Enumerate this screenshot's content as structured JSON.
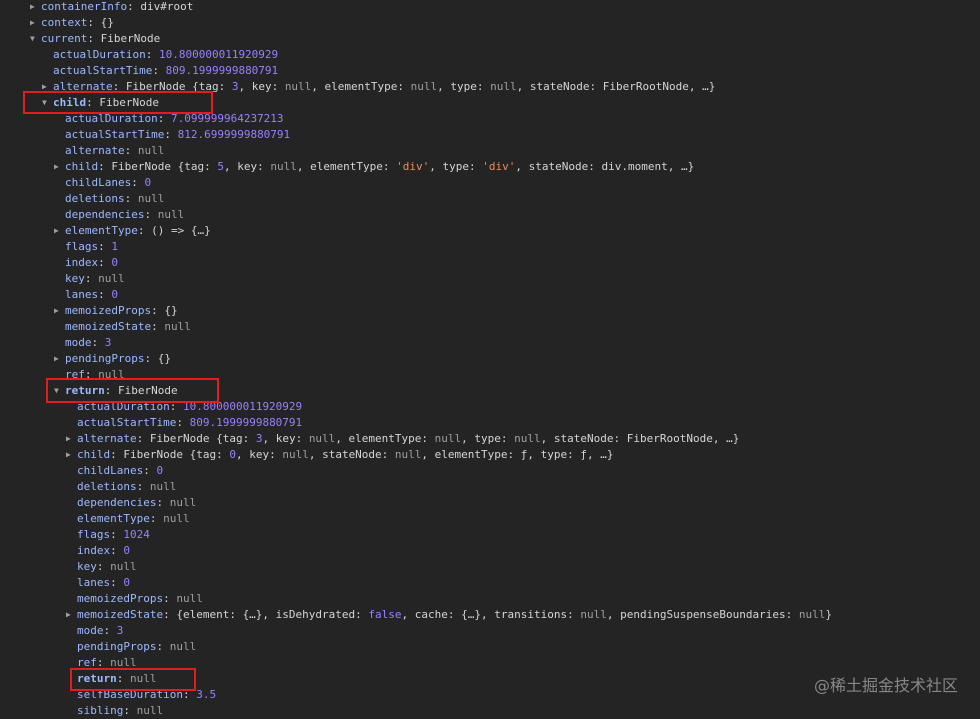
{
  "watermark": "@稀土掘金技术社区",
  "rows": [
    {
      "indent": 0,
      "tri": "right",
      "parts": [
        [
          "k",
          "containerInfo"
        ],
        [
          "p",
          ": "
        ],
        [
          "v",
          "div#root"
        ]
      ]
    },
    {
      "indent": 0,
      "tri": "right",
      "parts": [
        [
          "k",
          "context"
        ],
        [
          "p",
          ": {}"
        ]
      ]
    },
    {
      "indent": 0,
      "tri": "down",
      "parts": [
        [
          "k",
          "current"
        ],
        [
          "p",
          ": "
        ],
        [
          "v",
          "FiberNode"
        ]
      ]
    },
    {
      "indent": 1,
      "tri": "none",
      "parts": [
        [
          "k",
          "actualDuration"
        ],
        [
          "p",
          ": "
        ],
        [
          "num",
          "10.800000011920929"
        ]
      ]
    },
    {
      "indent": 1,
      "tri": "none",
      "parts": [
        [
          "k",
          "actualStartTime"
        ],
        [
          "p",
          ": "
        ],
        [
          "num",
          "809.1999999880791"
        ]
      ]
    },
    {
      "indent": 1,
      "tri": "right",
      "parts": [
        [
          "k",
          "alternate"
        ],
        [
          "p",
          ": "
        ],
        [
          "v",
          "FiberNode {tag: "
        ],
        [
          "num",
          "3"
        ],
        [
          "v",
          ", key: "
        ],
        [
          "n",
          "null"
        ],
        [
          "v",
          ", elementType: "
        ],
        [
          "n",
          "null"
        ],
        [
          "v",
          ", type: "
        ],
        [
          "n",
          "null"
        ],
        [
          "v",
          ", stateNode: "
        ],
        [
          "v",
          "FiberRootNode"
        ],
        [
          "v",
          ", …}"
        ]
      ]
    },
    {
      "indent": 1,
      "tri": "down",
      "parts": [
        [
          "kb",
          "child"
        ],
        [
          "p",
          ": "
        ],
        [
          "v",
          "FiberNode"
        ]
      ]
    },
    {
      "indent": 2,
      "tri": "none",
      "parts": [
        [
          "k",
          "actualDuration"
        ],
        [
          "p",
          ": "
        ],
        [
          "num",
          "7.099999964237213"
        ]
      ]
    },
    {
      "indent": 2,
      "tri": "none",
      "parts": [
        [
          "k",
          "actualStartTime"
        ],
        [
          "p",
          ": "
        ],
        [
          "num",
          "812.6999999880791"
        ]
      ]
    },
    {
      "indent": 2,
      "tri": "none",
      "parts": [
        [
          "k",
          "alternate"
        ],
        [
          "p",
          ": "
        ],
        [
          "n",
          "null"
        ]
      ]
    },
    {
      "indent": 2,
      "tri": "right",
      "parts": [
        [
          "k",
          "child"
        ],
        [
          "p",
          ": "
        ],
        [
          "v",
          "FiberNode {tag: "
        ],
        [
          "num",
          "5"
        ],
        [
          "v",
          ", key: "
        ],
        [
          "n",
          "null"
        ],
        [
          "v",
          ", elementType: "
        ],
        [
          "str",
          "'div'"
        ],
        [
          "v",
          ", type: "
        ],
        [
          "str",
          "'div'"
        ],
        [
          "v",
          ", stateNode: "
        ],
        [
          "v",
          "div.moment"
        ],
        [
          "v",
          ", …}"
        ]
      ]
    },
    {
      "indent": 2,
      "tri": "none",
      "parts": [
        [
          "k",
          "childLanes"
        ],
        [
          "p",
          ": "
        ],
        [
          "num",
          "0"
        ]
      ]
    },
    {
      "indent": 2,
      "tri": "none",
      "parts": [
        [
          "k",
          "deletions"
        ],
        [
          "p",
          ": "
        ],
        [
          "n",
          "null"
        ]
      ]
    },
    {
      "indent": 2,
      "tri": "none",
      "parts": [
        [
          "k",
          "dependencies"
        ],
        [
          "p",
          ": "
        ],
        [
          "n",
          "null"
        ]
      ]
    },
    {
      "indent": 2,
      "tri": "right",
      "parts": [
        [
          "k",
          "elementType"
        ],
        [
          "p",
          ": "
        ],
        [
          "v",
          "() => {…}"
        ]
      ]
    },
    {
      "indent": 2,
      "tri": "none",
      "parts": [
        [
          "k",
          "flags"
        ],
        [
          "p",
          ": "
        ],
        [
          "num",
          "1"
        ]
      ]
    },
    {
      "indent": 2,
      "tri": "none",
      "parts": [
        [
          "k",
          "index"
        ],
        [
          "p",
          ": "
        ],
        [
          "num",
          "0"
        ]
      ]
    },
    {
      "indent": 2,
      "tri": "none",
      "parts": [
        [
          "k",
          "key"
        ],
        [
          "p",
          ": "
        ],
        [
          "n",
          "null"
        ]
      ]
    },
    {
      "indent": 2,
      "tri": "none",
      "parts": [
        [
          "k",
          "lanes"
        ],
        [
          "p",
          ": "
        ],
        [
          "num",
          "0"
        ]
      ]
    },
    {
      "indent": 2,
      "tri": "right",
      "parts": [
        [
          "k",
          "memoizedProps"
        ],
        [
          "p",
          ": {}"
        ]
      ]
    },
    {
      "indent": 2,
      "tri": "none",
      "parts": [
        [
          "k",
          "memoizedState"
        ],
        [
          "p",
          ": "
        ],
        [
          "n",
          "null"
        ]
      ]
    },
    {
      "indent": 2,
      "tri": "none",
      "parts": [
        [
          "k",
          "mode"
        ],
        [
          "p",
          ": "
        ],
        [
          "num",
          "3"
        ]
      ]
    },
    {
      "indent": 2,
      "tri": "right",
      "parts": [
        [
          "k",
          "pendingProps"
        ],
        [
          "p",
          ": {}"
        ]
      ]
    },
    {
      "indent": 2,
      "tri": "none",
      "parts": [
        [
          "k",
          "ref"
        ],
        [
          "p",
          ": "
        ],
        [
          "n",
          "null"
        ]
      ]
    },
    {
      "indent": 2,
      "tri": "down",
      "parts": [
        [
          "kb",
          "return"
        ],
        [
          "p",
          ": "
        ],
        [
          "v",
          "FiberNode"
        ]
      ]
    },
    {
      "indent": 3,
      "tri": "none",
      "parts": [
        [
          "k",
          "actualDuration"
        ],
        [
          "p",
          ": "
        ],
        [
          "num",
          "10.800000011920929"
        ]
      ]
    },
    {
      "indent": 3,
      "tri": "none",
      "parts": [
        [
          "k",
          "actualStartTime"
        ],
        [
          "p",
          ": "
        ],
        [
          "num",
          "809.1999999880791"
        ]
      ]
    },
    {
      "indent": 3,
      "tri": "right",
      "parts": [
        [
          "k",
          "alternate"
        ],
        [
          "p",
          ": "
        ],
        [
          "v",
          "FiberNode {tag: "
        ],
        [
          "num",
          "3"
        ],
        [
          "v",
          ", key: "
        ],
        [
          "n",
          "null"
        ],
        [
          "v",
          ", elementType: "
        ],
        [
          "n",
          "null"
        ],
        [
          "v",
          ", type: "
        ],
        [
          "n",
          "null"
        ],
        [
          "v",
          ", stateNode: "
        ],
        [
          "v",
          "FiberRootNode"
        ],
        [
          "v",
          ", …}"
        ]
      ]
    },
    {
      "indent": 3,
      "tri": "right",
      "parts": [
        [
          "k",
          "child"
        ],
        [
          "p",
          ": "
        ],
        [
          "v",
          "FiberNode {tag: "
        ],
        [
          "num",
          "0"
        ],
        [
          "v",
          ", key: "
        ],
        [
          "n",
          "null"
        ],
        [
          "v",
          ", stateNode: "
        ],
        [
          "n",
          "null"
        ],
        [
          "v",
          ", elementType: "
        ],
        [
          "v",
          "ƒ"
        ],
        [
          "v",
          ", type: "
        ],
        [
          "v",
          "ƒ"
        ],
        [
          "v",
          ", …}"
        ]
      ]
    },
    {
      "indent": 3,
      "tri": "none",
      "parts": [
        [
          "k",
          "childLanes"
        ],
        [
          "p",
          ": "
        ],
        [
          "num",
          "0"
        ]
      ]
    },
    {
      "indent": 3,
      "tri": "none",
      "parts": [
        [
          "k",
          "deletions"
        ],
        [
          "p",
          ": "
        ],
        [
          "n",
          "null"
        ]
      ]
    },
    {
      "indent": 3,
      "tri": "none",
      "parts": [
        [
          "k",
          "dependencies"
        ],
        [
          "p",
          ": "
        ],
        [
          "n",
          "null"
        ]
      ]
    },
    {
      "indent": 3,
      "tri": "none",
      "parts": [
        [
          "k",
          "elementType"
        ],
        [
          "p",
          ": "
        ],
        [
          "n",
          "null"
        ]
      ]
    },
    {
      "indent": 3,
      "tri": "none",
      "parts": [
        [
          "k",
          "flags"
        ],
        [
          "p",
          ": "
        ],
        [
          "num",
          "1024"
        ]
      ]
    },
    {
      "indent": 3,
      "tri": "none",
      "parts": [
        [
          "k",
          "index"
        ],
        [
          "p",
          ": "
        ],
        [
          "num",
          "0"
        ]
      ]
    },
    {
      "indent": 3,
      "tri": "none",
      "parts": [
        [
          "k",
          "key"
        ],
        [
          "p",
          ": "
        ],
        [
          "n",
          "null"
        ]
      ]
    },
    {
      "indent": 3,
      "tri": "none",
      "parts": [
        [
          "k",
          "lanes"
        ],
        [
          "p",
          ": "
        ],
        [
          "num",
          "0"
        ]
      ]
    },
    {
      "indent": 3,
      "tri": "none",
      "parts": [
        [
          "k",
          "memoizedProps"
        ],
        [
          "p",
          ": "
        ],
        [
          "n",
          "null"
        ]
      ]
    },
    {
      "indent": 3,
      "tri": "right",
      "parts": [
        [
          "k",
          "memoizedState"
        ],
        [
          "p",
          ": {element: {…}, isDehydrated: "
        ],
        [
          "kw",
          "false"
        ],
        [
          "v",
          ", cache: {…}, transitions: "
        ],
        [
          "n",
          "null"
        ],
        [
          "v",
          ", pendingSuspenseBoundaries: "
        ],
        [
          "n",
          "null"
        ],
        [
          "v",
          "}"
        ]
      ]
    },
    {
      "indent": 3,
      "tri": "none",
      "parts": [
        [
          "k",
          "mode"
        ],
        [
          "p",
          ": "
        ],
        [
          "num",
          "3"
        ]
      ]
    },
    {
      "indent": 3,
      "tri": "none",
      "parts": [
        [
          "k",
          "pendingProps"
        ],
        [
          "p",
          ": "
        ],
        [
          "n",
          "null"
        ]
      ]
    },
    {
      "indent": 3,
      "tri": "none",
      "parts": [
        [
          "k",
          "ref"
        ],
        [
          "p",
          ": "
        ],
        [
          "n",
          "null"
        ]
      ]
    },
    {
      "indent": 3,
      "tri": "none",
      "parts": [
        [
          "kb",
          "return"
        ],
        [
          "p",
          ": "
        ],
        [
          "n",
          "null"
        ]
      ]
    },
    {
      "indent": 3,
      "tri": "none",
      "parts": [
        [
          "k",
          "selfBaseDuration"
        ],
        [
          "p",
          ": "
        ],
        [
          "num",
          "3.5"
        ]
      ]
    },
    {
      "indent": 3,
      "tri": "none",
      "parts": [
        [
          "k",
          "sibling"
        ],
        [
          "p",
          ": "
        ],
        [
          "n",
          "null"
        ]
      ]
    }
  ]
}
